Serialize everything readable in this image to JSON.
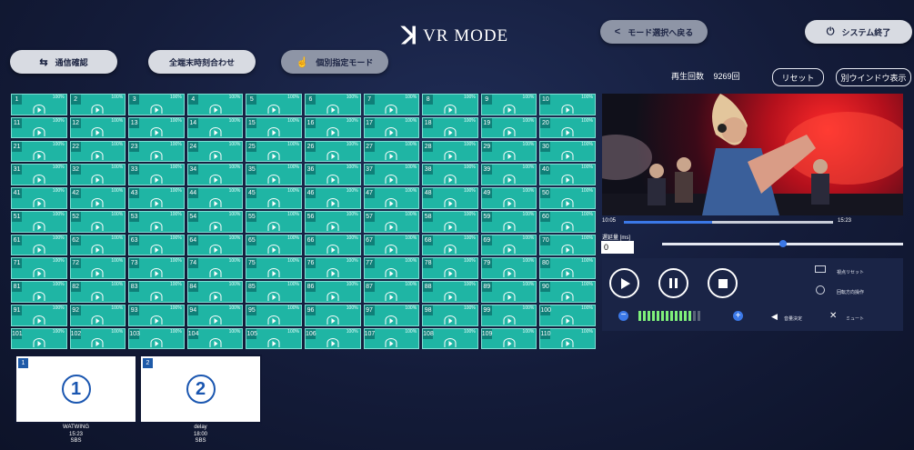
{
  "header": {
    "logo_mark": "ꓘ",
    "logo_text": "VR MODE",
    "back_label": "モード選択へ戻る",
    "back_icon": "<",
    "exit_label": "システム終了",
    "exit_icon": "⏻"
  },
  "toolbar": {
    "comm_label": "通信確認",
    "comm_icon": "⇆",
    "sync_label": "全端末時刻合わせ",
    "individual_label": "個別指定モード",
    "individual_icon": "☝"
  },
  "playback": {
    "count_label": "再生回数",
    "count_value": "9269回",
    "reset_label": "リセット",
    "window_label": "別ウインドウ表示"
  },
  "grid": {
    "percent": "100%",
    "cells": [
      "1",
      "2",
      "3",
      "4",
      "5",
      "6",
      "7",
      "8",
      "9",
      "10",
      "11",
      "12",
      "13",
      "14",
      "15",
      "16",
      "17",
      "18",
      "19",
      "20",
      "21",
      "22",
      "23",
      "24",
      "25",
      "26",
      "27",
      "28",
      "29",
      "30",
      "31",
      "32",
      "33",
      "34",
      "35",
      "36",
      "37",
      "38",
      "39",
      "40",
      "41",
      "42",
      "43",
      "44",
      "45",
      "46",
      "47",
      "48",
      "49",
      "50",
      "51",
      "52",
      "53",
      "54",
      "55",
      "56",
      "57",
      "58",
      "59",
      "60",
      "61",
      "62",
      "63",
      "64",
      "65",
      "66",
      "67",
      "68",
      "69",
      "70",
      "71",
      "72",
      "73",
      "74",
      "75",
      "76",
      "77",
      "78",
      "79",
      "80",
      "81",
      "82",
      "83",
      "84",
      "85",
      "86",
      "87",
      "88",
      "89",
      "90",
      "91",
      "92",
      "93",
      "94",
      "95",
      "96",
      "97",
      "98",
      "99",
      "100",
      "101",
      "102",
      "103",
      "104",
      "105",
      "106",
      "107",
      "108",
      "109",
      "110"
    ]
  },
  "thumbnails": [
    {
      "index": "1",
      "symbol": "①",
      "name": "WATWING",
      "time": "15:23",
      "tag": "SBS"
    },
    {
      "index": "2",
      "symbol": "②",
      "name": "delay",
      "time": "18:00",
      "tag": "SBS"
    }
  ],
  "player": {
    "current_time": "10:05",
    "total_time": "15:23",
    "progress_fraction": 0.42,
    "delay_label": "遅延量 [ms]",
    "delay_value": "0",
    "delay_slider_fraction": 0.5,
    "volume_level_fraction": 0.85,
    "sensor_reset_label": "視点リセット",
    "rotate_label": "回転方向操作",
    "volume_decide_label": "音量決定",
    "mute_label": "ミュート"
  },
  "colors": {
    "accent": "#1fb5a4",
    "background": "#141c3a",
    "progress": "#3b78e7",
    "volume": "#7ff07a"
  }
}
